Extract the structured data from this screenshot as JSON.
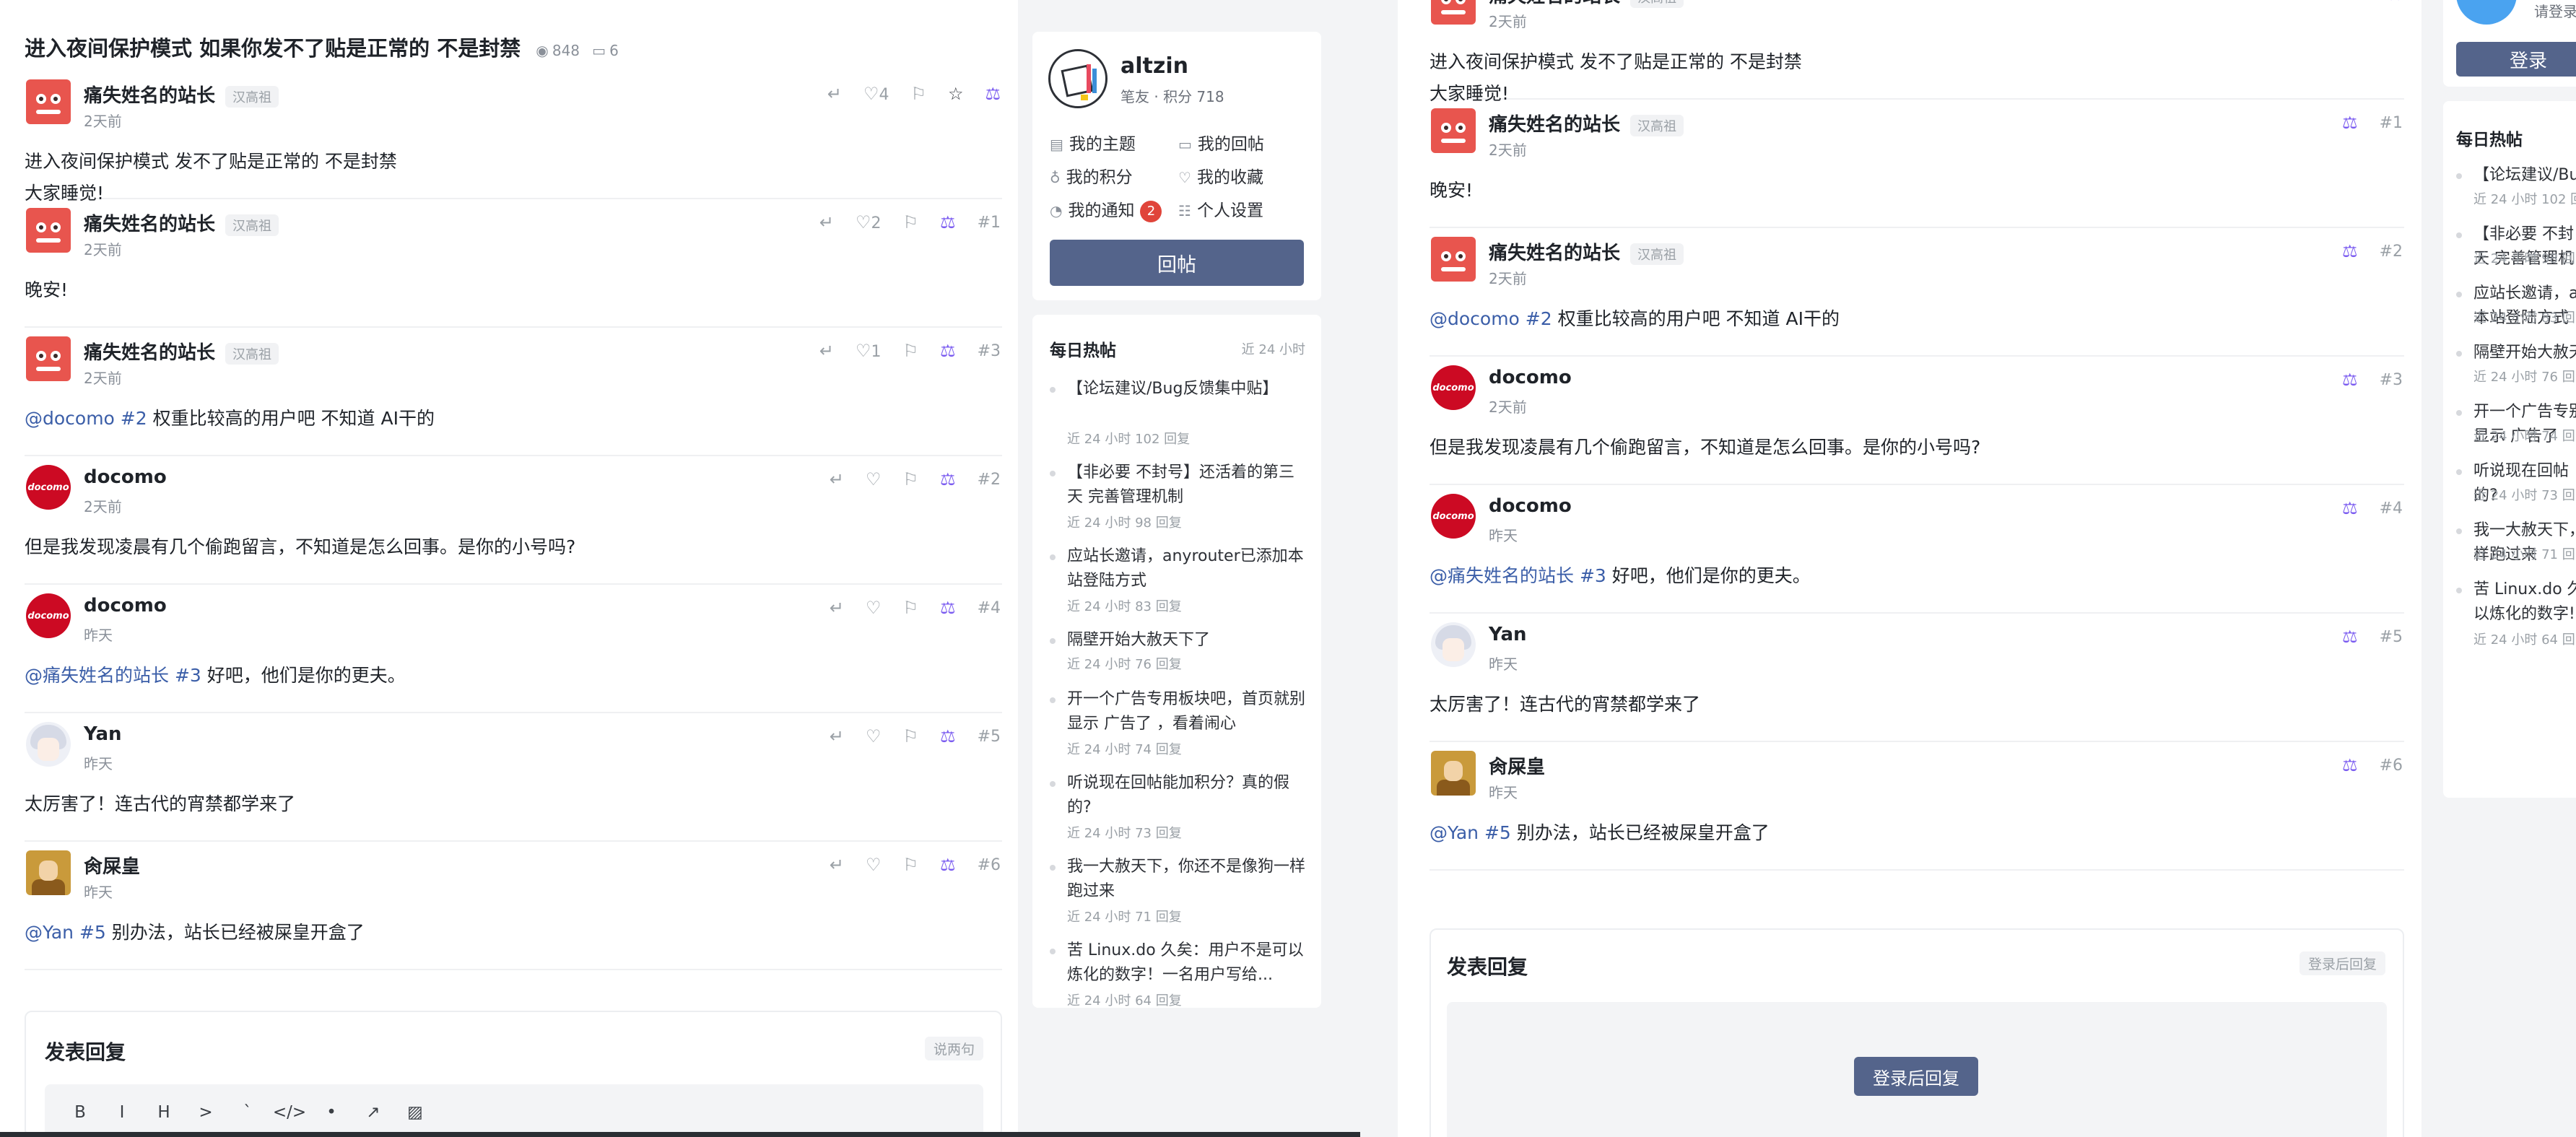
{
  "thread": {
    "title": "进入夜间保护模式 如果你发不了贴是正常的 不是封禁",
    "views": "848",
    "replies": "6"
  },
  "posts_left": [
    {
      "avatar": "robot",
      "author": "痛失姓名的站长",
      "badge": "汉高祖",
      "time": "2天前",
      "lines": [
        "进入夜间保护模式 发不了贴是正常的 不是封禁",
        "大家睡觉!"
      ],
      "likes": "4",
      "floor": ""
    },
    {
      "avatar": "robot",
      "author": "痛失姓名的站长",
      "badge": "汉高祖",
      "time": "2天前",
      "lines": [
        "晚安!"
      ],
      "likes": "2",
      "floor": "#1"
    },
    {
      "avatar": "robot",
      "author": "痛失姓名的站长",
      "badge": "汉高祖",
      "time": "2天前",
      "mention": "@docomo #2",
      "text": " 权重比较高的用户吧 不知道 AI干的",
      "likes": "1",
      "floor": "#3"
    },
    {
      "avatar": "docomo",
      "author": "docomo",
      "time": "2天前",
      "lines": [
        "但是我发现凌晨有几个偷跑留言，不知道是怎么回事。是你的小号吗?"
      ],
      "likes": "",
      "floor": "#2"
    },
    {
      "avatar": "docomo",
      "author": "docomo",
      "time": "昨天",
      "mention": "@痛失姓名的站长 #3",
      "text": " 好吧，他们是你的更夫。",
      "likes": "",
      "floor": "#4"
    },
    {
      "avatar": "yan",
      "author": "Yan",
      "time": "昨天",
      "lines": [
        "太厉害了！连古代的宵禁都学来了"
      ],
      "likes": "",
      "floor": "#5"
    },
    {
      "avatar": "huang",
      "author": "肏屎皇",
      "time": "昨天",
      "mention": "@Yan #5",
      "text": " 别办法，站长已经被屎皇开盒了",
      "likes": "",
      "floor": "#6"
    }
  ],
  "posts_right": [
    {
      "avatar": "robot",
      "author": "痛失姓名的站长",
      "badge": "汉高祖",
      "time": "2天前",
      "lines": [
        "进入夜间保护模式 发不了贴是正常的 不是封禁",
        "大家睡觉!"
      ],
      "floor": ""
    },
    {
      "avatar": "robot",
      "author": "痛失姓名的站长",
      "badge": "汉高祖",
      "time": "2天前",
      "lines": [
        "晚安!"
      ],
      "floor": "#1"
    },
    {
      "avatar": "robot",
      "author": "痛失姓名的站长",
      "badge": "汉高祖",
      "time": "2天前",
      "mention": "@docomo #2",
      "text": " 权重比较高的用户吧 不知道 AI干的",
      "floor": "#2"
    },
    {
      "avatar": "docomo",
      "author": "docomo",
      "time": "2天前",
      "lines": [
        "但是我发现凌晨有几个偷跑留言，不知道是怎么回事。是你的小号吗?"
      ],
      "floor": "#3"
    },
    {
      "avatar": "docomo",
      "author": "docomo",
      "time": "昨天",
      "mention": "@痛失姓名的站长 #3",
      "text": " 好吧，他们是你的更夫。",
      "floor": "#4"
    },
    {
      "avatar": "yan",
      "author": "Yan",
      "time": "昨天",
      "lines": [
        "太厉害了！连古代的宵禁都学来了"
      ],
      "floor": "#5"
    },
    {
      "avatar": "huang",
      "author": "肏屎皇",
      "time": "昨天",
      "mention": "@Yan #5",
      "text": " 别办法，站长已经被屎皇开盒了",
      "floor": "#6"
    }
  ],
  "reply_left": {
    "title": "发表回复",
    "hint": "说两句",
    "tools": [
      "B",
      "I",
      "H",
      ">",
      "`",
      "</>",
      "•",
      "↗",
      "▨"
    ]
  },
  "reply_right": {
    "title": "发表回复",
    "hint": "登录后回复",
    "button": "登录后回复"
  },
  "user": {
    "name": "altzin",
    "subtitle": "笔友 · 积分 718",
    "links": [
      "我的主题",
      "我的回帖",
      "我的积分",
      "我的收藏",
      "我的通知",
      "个人设置"
    ],
    "notifications": "2",
    "post_button": "回帖"
  },
  "hot": {
    "title": "每日热帖",
    "range": "近 24 小时",
    "items": [
      {
        "title": "【论坛建议/Bug反馈集中贴】",
        "sub": "近 24 小时 102 回复"
      },
      {
        "title": "【非必要 不封号】还活着的第三天 完善管理机制",
        "sub": "近 24 小时 98 回复"
      },
      {
        "title": "应站长邀请，anyrouter已添加本站登陆方式",
        "sub": "近 24 小时 83 回复"
      },
      {
        "title": "隔壁开始大赦天下了",
        "sub": "近 24 小时 76 回复"
      },
      {
        "title": "开一个广告专用板块吧，首页就别显示 广告了 ，看着闹心",
        "sub": "近 24 小时 74 回复"
      },
      {
        "title": "听说现在回帖能加积分？真的假的?",
        "sub": "近 24 小时 73 回复"
      },
      {
        "title": "我一大赦天下，你还不是像狗一样跑过来",
        "sub": "近 24 小时 71 回复"
      },
      {
        "title": "苦 Linux.do 久矣：用户不是可以炼化的数字！一名用户写给...",
        "sub": "近 24 小时 64 回复"
      }
    ]
  },
  "right_sidebar": {
    "login_hint": "请登录",
    "login_button": "登录",
    "hot_title": "每日热帖",
    "items": [
      {
        "title": "【论坛建议/Bu",
        "sub": "近 24 小时 102 回"
      },
      {
        "title": "【非必要 不封天 完善管理机",
        "sub": "近 24 小时 98 回"
      },
      {
        "title": "应站长邀请，a本站登陆方式",
        "sub": "近 24 小时 83 回"
      },
      {
        "title": "隔壁开始大赦天",
        "sub": "近 24 小时 76 回"
      },
      {
        "title": "开一个广告专别显示 广告了",
        "sub": "近 24 小时 74 回"
      },
      {
        "title": "听说现在回帖的?",
        "sub": "近 24 小时 73 回"
      },
      {
        "title": "我一大赦天下，样跑过来",
        "sub": "近 24 小时 71 回"
      },
      {
        "title": "苦 Linux.do 久以炼化的数字!",
        "sub": "近 24 小时 64 回"
      }
    ]
  }
}
